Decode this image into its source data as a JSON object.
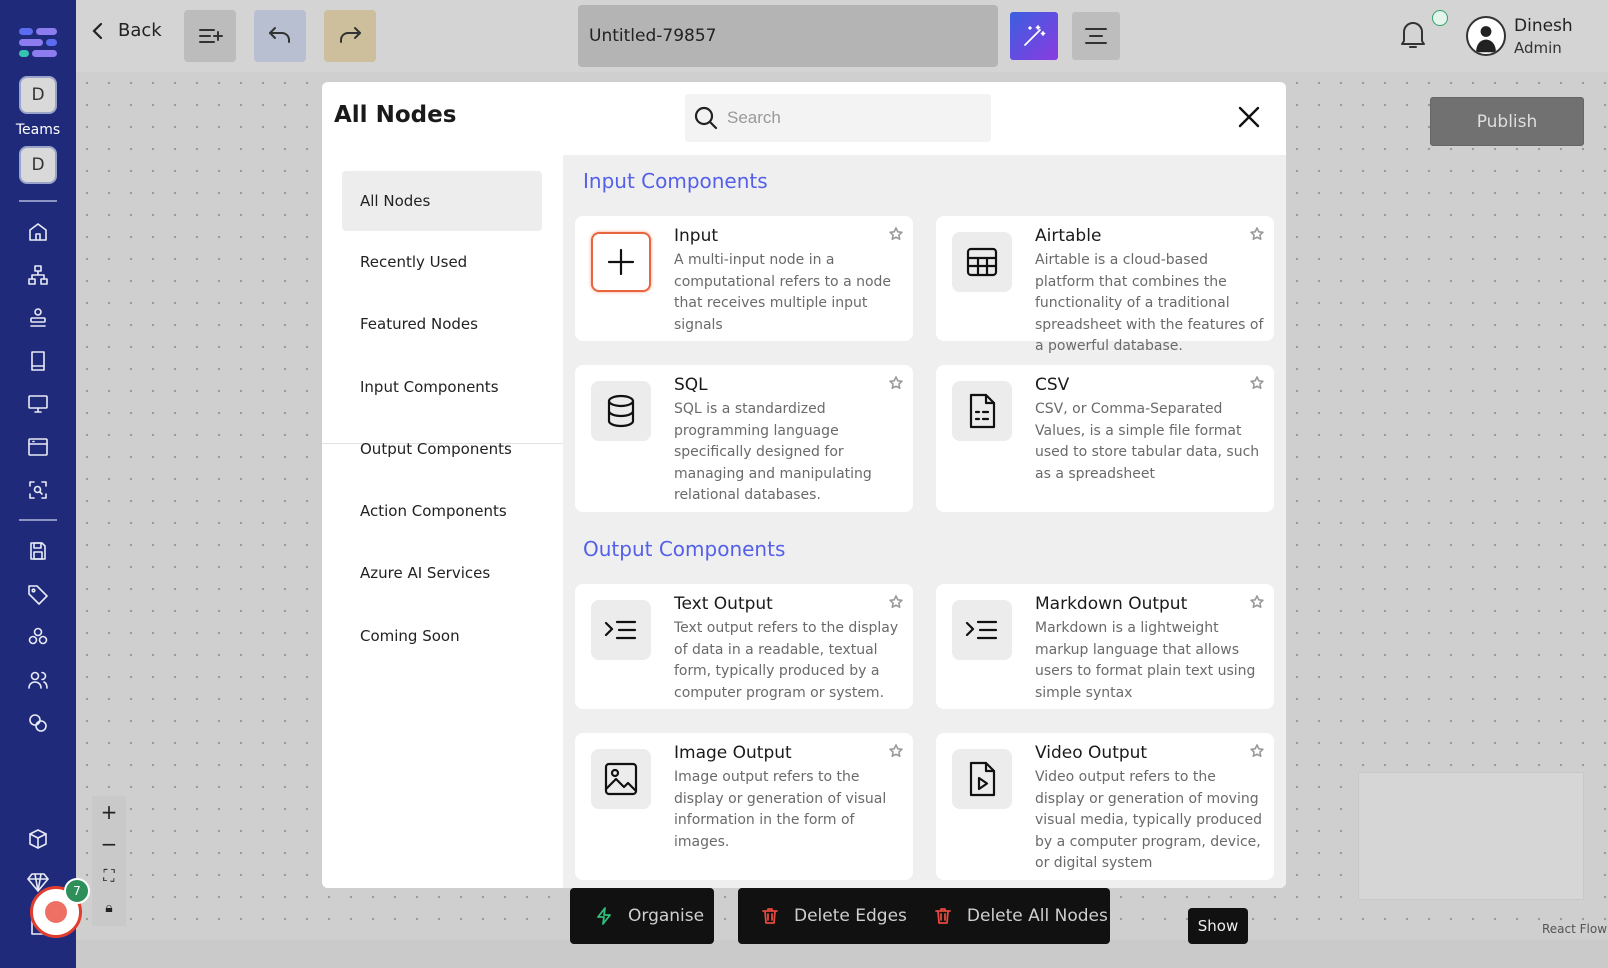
{
  "topbar": {
    "back_label": "Back",
    "title_value": "Untitled-79857",
    "user_name": "Dinesh",
    "user_role": "Admin"
  },
  "sidebar": {
    "team_initial_1": "D",
    "teams_label": "Teams",
    "team_initial_2": "D"
  },
  "canvas": {
    "publish_label": "Publish",
    "organise_label": "Organise",
    "delete_edges_label": "Delete Edges",
    "delete_all_label": "Delete All Nodes",
    "show_label": "Show",
    "react_flow_label": "React Flow",
    "notification_count": "7"
  },
  "modal": {
    "title": "All Nodes",
    "search_placeholder": "Search",
    "nav": [
      {
        "label": "All Nodes"
      },
      {
        "label": "Recently Used"
      },
      {
        "label": "Featured Nodes"
      },
      {
        "label": "Input Components"
      },
      {
        "label": "Output Components"
      },
      {
        "label": "Action Components"
      },
      {
        "label": "Azure AI Services"
      },
      {
        "label": "Coming Soon"
      }
    ],
    "sections": [
      {
        "title": "Input Components",
        "cards": [
          {
            "title": "Input",
            "icon": "plus-icon",
            "desc": "A multi-input node in a computational refers to a node that receives multiple input signals"
          },
          {
            "title": "Airtable",
            "icon": "table-icon",
            "desc": "Airtable is a cloud-based platform that combines the functionality of a traditional spreadsheet with the features of a powerful database."
          },
          {
            "title": "SQL",
            "icon": "database-icon",
            "desc": "SQL is a standardized programming language specifically designed for managing and manipulating relational databases."
          },
          {
            "title": "CSV",
            "icon": "file-csv-icon",
            "desc": "CSV, or Comma-Separated Values, is a simple file format used to store tabular data, such as a spreadsheet"
          }
        ]
      },
      {
        "title": "Output Components",
        "cards": [
          {
            "title": "Text Output",
            "icon": "terminal-list-icon",
            "desc": "Text output refers to the display of data in a readable, textual form, typically produced by a computer program or system."
          },
          {
            "title": "Markdown Output",
            "icon": "terminal-list-icon",
            "desc": "Markdown is a lightweight markup language that allows users to format plain text using simple syntax"
          },
          {
            "title": "Image Output",
            "icon": "image-icon",
            "desc": "Image output refers to the display or generation of visual information in the form of images."
          },
          {
            "title": "Video Output",
            "icon": "video-file-icon",
            "desc": "Video output refers to the display or generation of moving visual media, typically produced by a computer program, device, or digital system"
          }
        ]
      }
    ]
  },
  "colors": {
    "sidebar": "#1f2b7a",
    "section_title": "#5460e8",
    "highlight_border": "#e8663f"
  }
}
